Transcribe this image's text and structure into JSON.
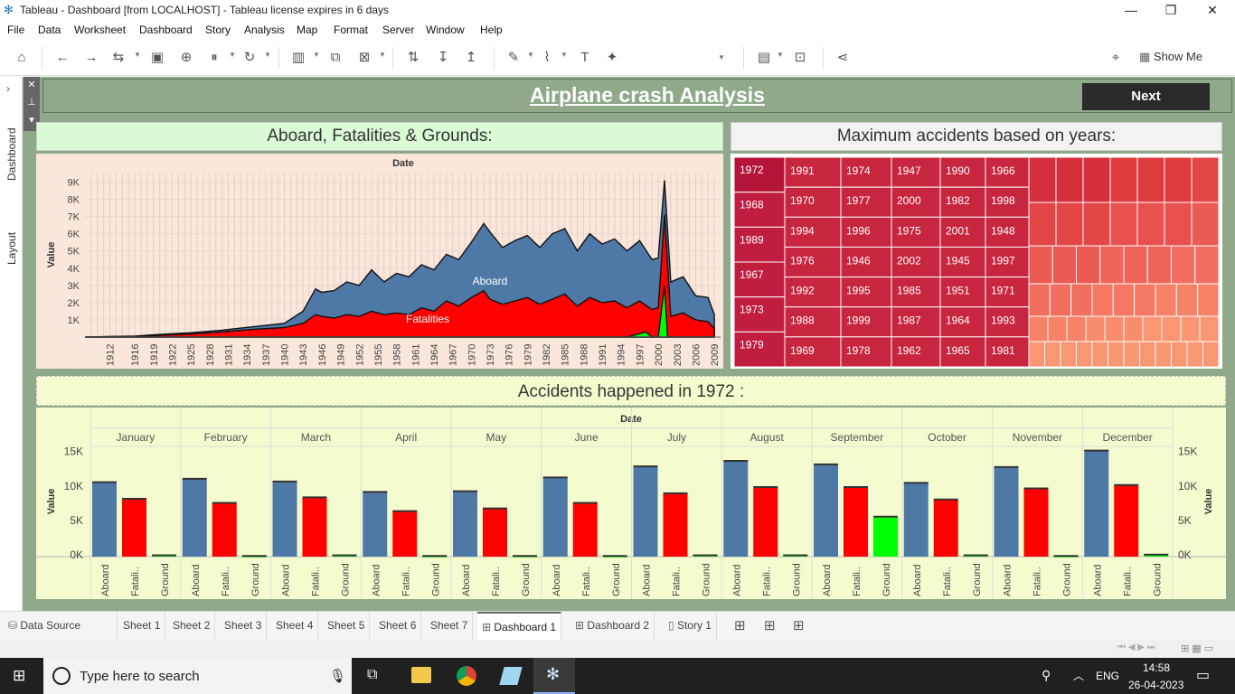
{
  "window": {
    "title": "Tableau - Dashboard [from LOCALHOST] - Tableau license expires in 6 days",
    "minimize": "—",
    "restore": "❐",
    "close": "✕"
  },
  "menu": [
    "File",
    "Data",
    "Worksheet",
    "Dashboard",
    "Story",
    "Analysis",
    "Map",
    "Format",
    "Server",
    "Window",
    "Help"
  ],
  "toolbar": {
    "show_me": "Show Me"
  },
  "left_rail": {
    "tabs": [
      "Dashboard",
      "Layout"
    ]
  },
  "dashboard": {
    "title": "Airplane crash Analysis",
    "next_button": "Next",
    "colors": {
      "aboard": "#4e79a7",
      "fatalities": "#ff0000",
      "ground": "#00ff00",
      "background": "#8fa98a"
    }
  },
  "sheet1": {
    "header": "Aboard, Fatalities & Grounds:"
  },
  "sheet2": {
    "header": "Maximum accidents based on years:"
  },
  "sheet3": {
    "header": "Accidents happened in 1972 :"
  },
  "chart_data": [
    {
      "type": "area",
      "title": "Date",
      "ylabel": "Value",
      "ylim": [
        0,
        9500
      ],
      "yticks": [
        "1K",
        "2K",
        "3K",
        "4K",
        "5K",
        "6K",
        "7K",
        "8K",
        "9K"
      ],
      "x_tick_labels": [
        "1912",
        "1916",
        "1919",
        "1922",
        "1925",
        "1928",
        "1931",
        "1934",
        "1937",
        "1940",
        "1943",
        "1946",
        "1949",
        "1952",
        "1955",
        "1958",
        "1961",
        "1964",
        "1967",
        "1970",
        "1973",
        "1976",
        "1979",
        "1982",
        "1985",
        "1988",
        "1991",
        "1994",
        "1997",
        "2000",
        "2003",
        "2006",
        "2009"
      ],
      "annotations": [
        "Aboard",
        "Fatalities"
      ],
      "series": [
        {
          "name": "Aboard",
          "x": [
            1908,
            1912,
            1916,
            1920,
            1925,
            1930,
            1935,
            1940,
            1943,
            1945,
            1946,
            1948,
            1950,
            1952,
            1954,
            1956,
            1958,
            1960,
            1962,
            1964,
            1966,
            1968,
            1970,
            1972,
            1973,
            1975,
            1977,
            1979,
            1981,
            1983,
            1985,
            1987,
            1989,
            1991,
            1993,
            1995,
            1997,
            1999,
            2000,
            2001,
            2002,
            2004,
            2006,
            2008,
            2009
          ],
          "y": [
            0,
            30,
            60,
            150,
            250,
            400,
            600,
            800,
            1500,
            2800,
            2600,
            2700,
            3200,
            3000,
            3900,
            3200,
            3700,
            3500,
            4200,
            3900,
            4800,
            4500,
            5500,
            6600,
            6100,
            5200,
            5600,
            5900,
            5200,
            6000,
            6300,
            5000,
            6000,
            5400,
            5700,
            5000,
            5600,
            4500,
            4600,
            9100,
            3200,
            3500,
            2400,
            2300,
            1300
          ]
        },
        {
          "name": "Fatalities",
          "x": [
            1908,
            1912,
            1916,
            1920,
            1925,
            1930,
            1935,
            1940,
            1943,
            1945,
            1946,
            1948,
            1950,
            1952,
            1954,
            1956,
            1958,
            1960,
            1962,
            1964,
            1966,
            1968,
            1970,
            1972,
            1973,
            1975,
            1977,
            1979,
            1981,
            1983,
            1985,
            1987,
            1989,
            1991,
            1993,
            1995,
            1997,
            1999,
            2000,
            2001,
            2002,
            2004,
            2006,
            2008,
            2009
          ],
          "y": [
            0,
            20,
            40,
            100,
            180,
            300,
            450,
            550,
            800,
            1300,
            1200,
            1100,
            1300,
            1200,
            1500,
            1300,
            1400,
            1300,
            1700,
            1500,
            2100,
            1800,
            2300,
            2700,
            2200,
            1900,
            2100,
            2300,
            1900,
            2200,
            2500,
            1800,
            2300,
            2000,
            2100,
            1700,
            2100,
            1600,
            1700,
            7100,
            1200,
            1400,
            1000,
            900,
            500
          ]
        },
        {
          "name": "Ground",
          "x": [
            1908,
            1990,
            1995,
            1998,
            1999,
            2000,
            2001,
            2001.5,
            2002,
            2009
          ],
          "y": [
            0,
            0,
            0,
            300,
            0,
            0,
            3000,
            0,
            0,
            0
          ]
        }
      ]
    },
    {
      "type": "heatmap",
      "title": "Maximum accidents based on years",
      "labeled_years": [
        [
          "1972",
          "1968",
          "1989",
          "1967",
          "1973",
          "1979"
        ],
        [
          "1991",
          "1970",
          "1994",
          "1976",
          "1992",
          "1988",
          "1969"
        ],
        [
          "1974",
          "1977",
          "1996",
          "1946",
          "1995",
          "1999",
          "1978"
        ],
        [
          "1947",
          "2000",
          "1975",
          "2002",
          "1985",
          "1987",
          "1962"
        ],
        [
          "1990",
          "1982",
          "2001",
          "1945",
          "1951",
          "1964",
          "1965"
        ],
        [
          "1966",
          "1998",
          "1948",
          "1997",
          "1971",
          "1993",
          "1981"
        ]
      ]
    },
    {
      "type": "bar",
      "title": "Date",
      "ylabel": "Value",
      "ylim": [
        0,
        16000
      ],
      "yticks": [
        "0K",
        "5K",
        "10K",
        "15K"
      ],
      "categories": [
        "January",
        "February",
        "March",
        "April",
        "May",
        "June",
        "July",
        "August",
        "September",
        "October",
        "November",
        "December"
      ],
      "sub_labels": [
        "Aboard",
        "Fatali..",
        "Ground"
      ],
      "series": [
        {
          "name": "Aboard",
          "values": [
            10800,
            11300,
            10900,
            9400,
            9500,
            11500,
            13100,
            13900,
            13400,
            10700,
            13000,
            15400
          ]
        },
        {
          "name": "Fatalities",
          "values": [
            8400,
            7800,
            8600,
            6600,
            7000,
            7800,
            9200,
            10100,
            10100,
            8300,
            9900,
            10400
          ]
        },
        {
          "name": "Ground",
          "values": [
            200,
            100,
            200,
            100,
            100,
            100,
            200,
            200,
            5800,
            200,
            100,
            300
          ]
        }
      ]
    }
  ],
  "tabs": [
    {
      "label": "Data Source",
      "icon": "database-icon"
    },
    {
      "label": "Sheet 1"
    },
    {
      "label": "Sheet 2"
    },
    {
      "label": "Sheet 3"
    },
    {
      "label": "Sheet 4"
    },
    {
      "label": "Sheet 5"
    },
    {
      "label": "Sheet 6"
    },
    {
      "label": "Sheet 7"
    },
    {
      "label": "Dashboard 1",
      "active": true
    },
    {
      "label": "Dashboard 2"
    },
    {
      "label": "Story 1"
    }
  ],
  "taskbar": {
    "search_placeholder": "Type here to search",
    "lang": "ENG",
    "time": "14:58",
    "date": "26-04-2023"
  }
}
